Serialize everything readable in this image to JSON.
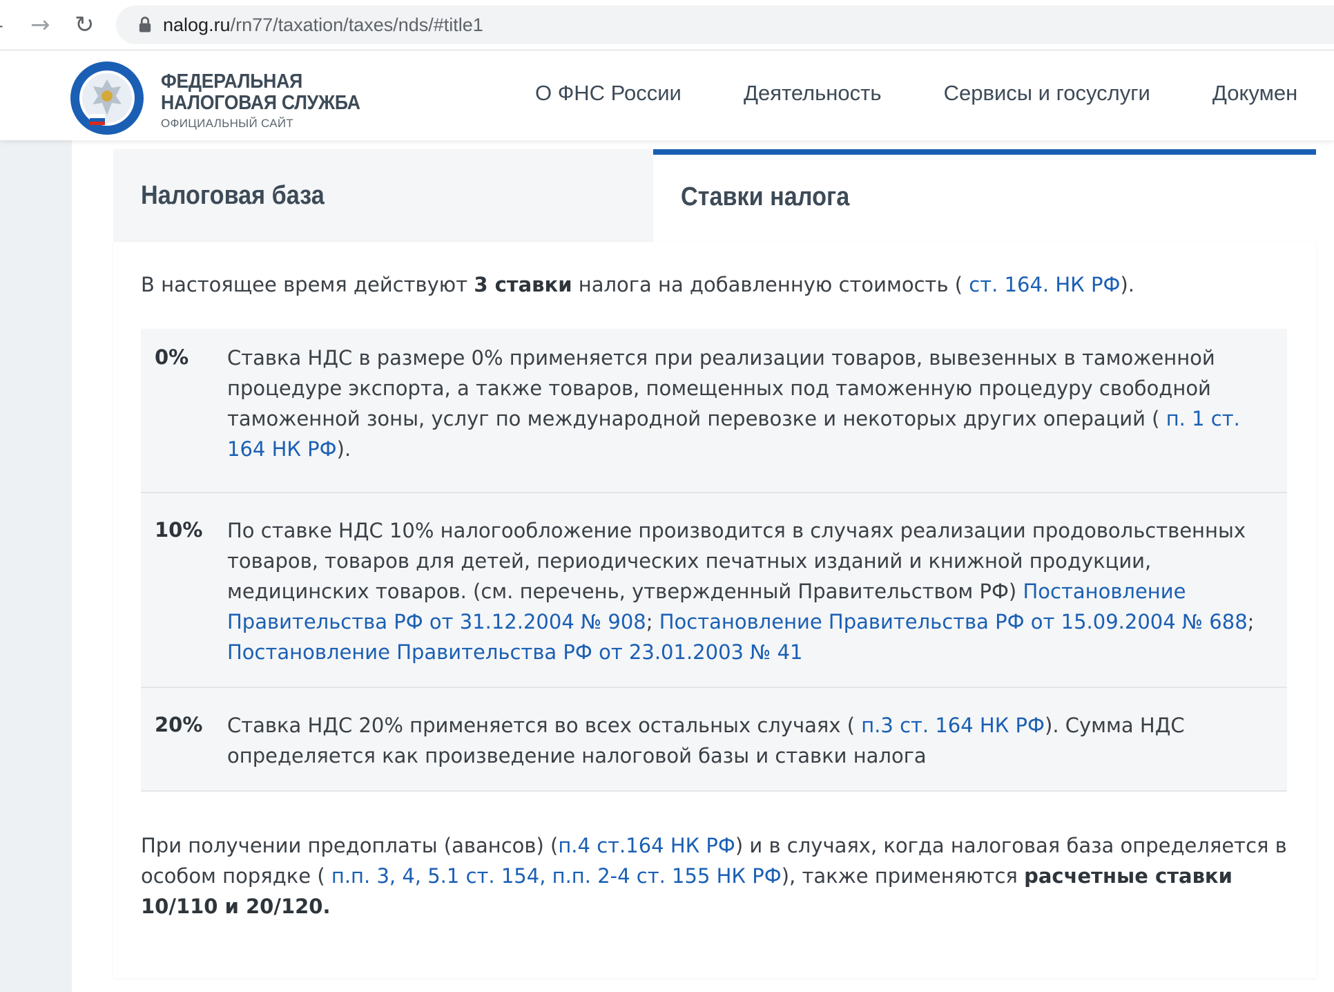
{
  "browser": {
    "url_host": "nalog.ru",
    "url_path": "/rn77/taxation/taxes/nds/#title1"
  },
  "header": {
    "brand_line1": "ФЕДЕРАЛЬНАЯ",
    "brand_line2": "НАЛОГОВАЯ СЛУЖБА",
    "brand_sub": "ОФИЦИАЛЬНЫЙ САЙТ",
    "nav": [
      "О ФНС России",
      "Деятельность",
      "Сервисы и госуслуги",
      "Докумен"
    ]
  },
  "tabs": {
    "tab1": "Налоговая база",
    "tab2": "Ставки налога"
  },
  "intro": {
    "before": "В настоящее время действуют ",
    "bold": "3 ставки",
    "after": " налога на добавленную стоимость ( ",
    "link": "ст. 164. НК РФ",
    "end": ")."
  },
  "rates": [
    {
      "pct": "0%",
      "text": "Ставка НДС в размере 0% применяется при реализации товаров, вывезенных в таможенной процедуре экспорта, а также товаров, помещенных под таможенную процедуру свободной таможенной зоны, услуг по международной перевозке и некоторых других операций ( ",
      "link": "п. 1 ст. 164 НК РФ",
      "end": ")."
    },
    {
      "pct": "10%",
      "text": "По ставке НДС 10% налогообложение производится в случаях реализации продовольственных товаров, товаров для детей, периодических печатных изданий и книжной продукции, медицинских товаров. (см. перечень, утвержденный Правительством РФ) ",
      "link1": "Постановление Правительства РФ от 31.12.2004 № 908",
      "sep1": "; ",
      "link2": "Постановление Правительства РФ от 15.09.2004 № 688",
      "sep2": "; ",
      "link3": "Постановление Правительства РФ от 23.01.2003 № 41"
    },
    {
      "pct": "20%",
      "text": "Ставка НДС 20% применяется во всех остальных случаях ( ",
      "link": "п.3 ст. 164 НК РФ",
      "end": "). Сумма НДС определяется как произведение налоговой базы и ставки налога"
    }
  ],
  "footer": {
    "t1": "При получении предоплаты (авансов) (",
    "link1": "п.4 ст.164 НК РФ",
    "t2": ") и в случаях, когда налоговая база определяется в особом порядке ( ",
    "link2": "п.п. 3, 4, 5.1 ст. 154, п.п. 2-4 ст. 155 НК РФ",
    "t3": "), также применяются ",
    "bold": "расчетные ставки 10/110 и 20/120."
  },
  "colors": {
    "link": "#1a5fb4",
    "active_tab_border": "#1a5fb4"
  }
}
